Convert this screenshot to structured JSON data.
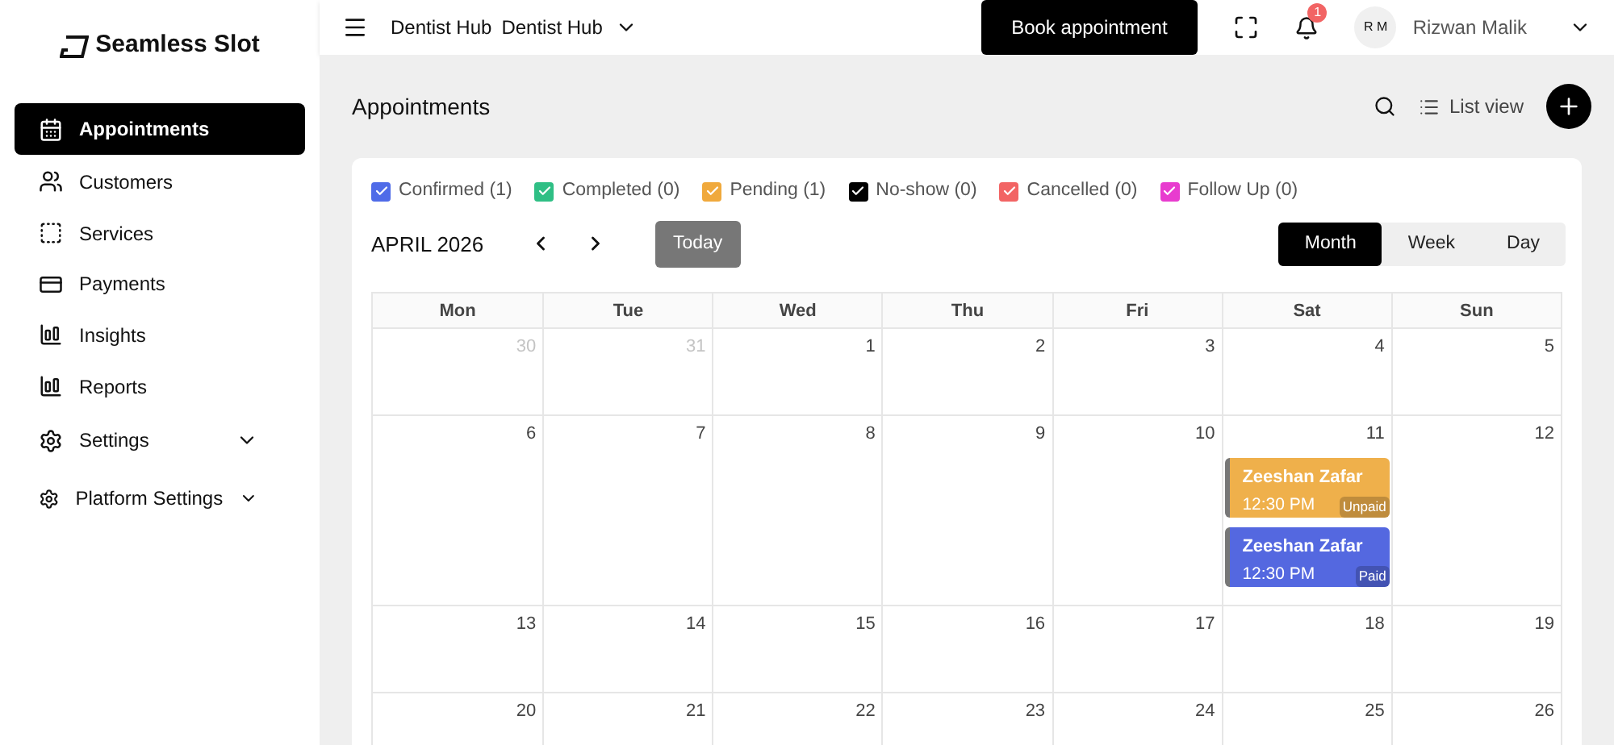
{
  "brand": "Seamless Slot",
  "sidebar": {
    "items": [
      {
        "label": "Appointments",
        "selected": true
      },
      {
        "label": "Customers",
        "selected": false
      },
      {
        "label": "Services",
        "selected": false
      },
      {
        "label": "Payments",
        "selected": false
      },
      {
        "label": "Insights",
        "selected": false
      },
      {
        "label": "Reports",
        "selected": false
      },
      {
        "label": "Settings",
        "selected": false,
        "expandable": true
      },
      {
        "label": "Platform Settings",
        "selected": false,
        "expandable": true
      }
    ]
  },
  "header": {
    "org_1": "Dentist Hub",
    "org_2": "Dentist Hub",
    "book_button": "Book appointment",
    "notification_count": "1",
    "user_initials": "R M",
    "user_name": "Rizwan Malik"
  },
  "page": {
    "title": "Appointments",
    "list_view": "List view"
  },
  "legend": [
    {
      "label": "Confirmed (1)",
      "color": "#4f6be8",
      "checked": true
    },
    {
      "label": "Completed (0)",
      "color": "#2fbf85",
      "checked": true
    },
    {
      "label": "Pending (1)",
      "color": "#f0a93c",
      "checked": true
    },
    {
      "label": "No-show (0)",
      "color": "#000000",
      "checked": true
    },
    {
      "label": "Cancelled (0)",
      "color": "#f26464",
      "checked": true
    },
    {
      "label": "Follow Up (0)",
      "color": "#e83ccf",
      "checked": true
    }
  ],
  "calendar": {
    "month": "APRIL 2026",
    "today": "Today",
    "views": [
      {
        "label": "Month",
        "selected": true
      },
      {
        "label": "Week",
        "selected": false
      },
      {
        "label": "Day",
        "selected": false
      }
    ],
    "weekdays": [
      "Mon",
      "Tue",
      "Wed",
      "Thu",
      "Fri",
      "Sat",
      "Sun"
    ],
    "weeks": [
      {
        "days": [
          {
            "day": "30",
            "muted": true
          },
          {
            "day": "31",
            "muted": true
          },
          {
            "day": "1",
            "muted": false
          },
          {
            "day": "2",
            "muted": false
          },
          {
            "day": "3",
            "muted": false
          },
          {
            "day": "4",
            "muted": false
          },
          {
            "day": "5",
            "muted": false
          }
        ]
      },
      {
        "days": [
          {
            "day": "6",
            "muted": false
          },
          {
            "day": "7",
            "muted": false
          },
          {
            "day": "8",
            "muted": false
          },
          {
            "day": "9",
            "muted": false
          },
          {
            "day": "10",
            "muted": false
          },
          {
            "day": "11",
            "muted": false,
            "events": [
              {
                "name": "Zeeshan Zafar",
                "time": "12:30 PM",
                "badge": "Unpaid",
                "color": "#efb04b"
              },
              {
                "name": "Zeeshan Zafar",
                "time": "12:30 PM",
                "badge": "Paid",
                "color": "#5468e0"
              }
            ]
          },
          {
            "day": "12",
            "muted": false
          }
        ]
      },
      {
        "days": [
          {
            "day": "13",
            "muted": false
          },
          {
            "day": "14",
            "muted": false
          },
          {
            "day": "15",
            "muted": false
          },
          {
            "day": "16",
            "muted": false
          },
          {
            "day": "17",
            "muted": false
          },
          {
            "day": "18",
            "muted": false
          },
          {
            "day": "19",
            "muted": false
          }
        ]
      },
      {
        "days": [
          {
            "day": "20",
            "muted": false
          },
          {
            "day": "21",
            "muted": false
          },
          {
            "day": "22",
            "muted": false
          },
          {
            "day": "23",
            "muted": false
          },
          {
            "day": "24",
            "muted": false
          },
          {
            "day": "25",
            "muted": false
          },
          {
            "day": "26",
            "muted": false
          }
        ]
      }
    ]
  }
}
